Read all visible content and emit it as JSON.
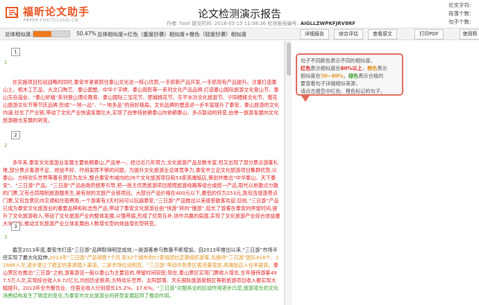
{
  "header": {
    "logo_text": "福昕论文助手",
    "logo_sub": "PAPER.FOXITCLOUD.CN",
    "title": "论文检测演示报告",
    "meta": "作者: foxit   提交时间: 2018-05-15 11:08:36   检测报告编号:",
    "report_code": "AIGLLZWPKFJRV8RF",
    "stats": [
      "论文字符:",
      "段落个数:",
      "句子个数:"
    ]
  },
  "toolbar": {
    "similarity_label": "总体相似度:",
    "similarity_value": 50.47,
    "similarity_text": "50.47%",
    "legend_text": "总体相似度=红色（重度抄袭）相似度+橙色（轻度抄袭）相似度",
    "buttons": [
      "详细报告",
      "综合评估",
      "查看原文",
      "打印PDF",
      "使用帮"
    ]
  },
  "colors": {
    "red": "#e02020",
    "orange": "#e0901f",
    "green": "#3a9b2e",
    "progress": "#f07a1c",
    "note_border": "#e06a5a"
  },
  "document": {
    "paragraphs": [
      {
        "page": "1",
        "number": "1",
        "segments": [
          {
            "c": "red",
            "t": "在实施项目拉动战略的同时,泰安市紧紧抓住泰山文化这一核心优势,一手抓新产品开发,一手抓现有产品提升。注重打造泰山土、祝木工艺品、大汶口陶艺、泰山面塑、中华十字绣、泰山观影等一系列文化产品品牌,打造泰山国际旅游文化登山节、泰山东岳庙会、“泰山祈福”系列登山理论教育、泰山国际三宝花节、肥城桃花节、东平水浒文化旅游节、宁阳蟋蟀文化节、蛋花山旅游文化节等节庆品牌,形成“一地一品”、“一地多品”的良好格局。文化品牌的塑造进一步丰富提升了泰安、泰山旅游的文化内涵,拉长了产业链,带动了文化产业快速发展壮大,实现了由单纯依赖泰山向依赖泰山、多点联动的转变,由单一旅游发展向文化旅游融合发展的转变。"
          }
        ]
      },
      {
        "page": "2",
        "number": "2",
        "segments": [
          {
            "c": "red",
            "t": "多年来,泰安文化旅游业发展主要依赖泰山,产品单一。经过近几年努力,文化旅游产品总数丰富,但又出现了部分景点游客扎堆,部分景点客源不足、效益不好、作用发挥不够的问题。为提升文化旅游业总体竞争力,泰安市立足文化旅游项目集群优势,以泰山、方特欢乐世界等著名景区为龙头,整合泰安市域内的26个文化旅游项目和53家高端饭店,策划并推出“中华泰山、天下泰安”、“三日游”产品。“三日游”产品由政府统筹引导,把一批主优质旅游项目按照旅游线路等组合成统一产品,取代以前散点分散的门票,又有合同限制旅游服务生,是有效的文旅产业链项目。大部分产品价格在400元以下,最低的仅为253元,既包含旅游景点门票,又包含景区内交通和住宿费用,一个游客有3天时间可以玩遍泰安,“三日游”产品推出以来很受散客欢迎,目前,“三日游”产品已成为泰安文化旅游业的重要品牌和标志性产品,带动了泰安文化旅游业由“快游”转向“慢游”,延长了游客在泰安的停留时间,提升了文化旅游收入,带动了文化旅游产业的整体发展,以强带弱,形成了优势互补,协作共赢的局面,实现了文化旅游产业综合效益最大化目标,推动文化旅游产业立体发展由人数增长型向效益增长型转变。"
          }
        ]
      },
      {
        "page": "3",
        "number": "3",
        "segments": [
          {
            "c": "black",
            "t": "截至2013年底,泰安市打造“三日游”品牌取得明显成效,一是游客参与数量不断增加。自2013年推出以来,“三日游”市场半径实现了最大化延伸,"
          },
          {
            "c": "orange",
            "t": "2013年“三日游”产品销售7个月,有32个城市的57家组团社定期组织游客,共接待“三日游”团队416个、12886人次,逐步建立了稳定的客源输入渠道。二是市场拉动明显。“三日游”带动中各景区客流量增加,高端饭店入住率提高。"
          },
          {
            "c": "red",
            "t": "泰山景区在推出“三日游”之前,游客游览一般以泰山为主要目的,停留时间较短;现在,泰山景区实现门票收入增长,全年接待游客497.5万人次,实现综合收入9.72亿元,均创历史新高;方特欢乐世界、太阳部落、天乐国际旅游度假区等新旅游项目收入都实现大幅提升。2013年全市餐饮业、住宿业收入分别增长15.2%、17.6%。"
          },
          {
            "c": "green",
            "t": "“三日游”对服务业的拉动作用逐步凸显,旅游增长的文化消费结构发生了明显的变化,为泰安市文化旅游业的转型发展起到了推动作用。"
          }
        ]
      }
    ]
  },
  "note": {
    "line1": "句子不同颜色表示不同的相似度，",
    "red_word": "红色",
    "line2a": "表示相似度在",
    "red_range": "80%以上",
    "line2b": "，",
    "orange_word": "橙色",
    "line2c": "表示",
    "line3a": "相似度在",
    "orange_range": "50~80%",
    "line3b": "，",
    "green_word": "绿色",
    "line3c": "表示合格的",
    "line4": "要查看句子详细相似来源，",
    "line5": "请点击报告中红色、橙色标记的句子。"
  }
}
